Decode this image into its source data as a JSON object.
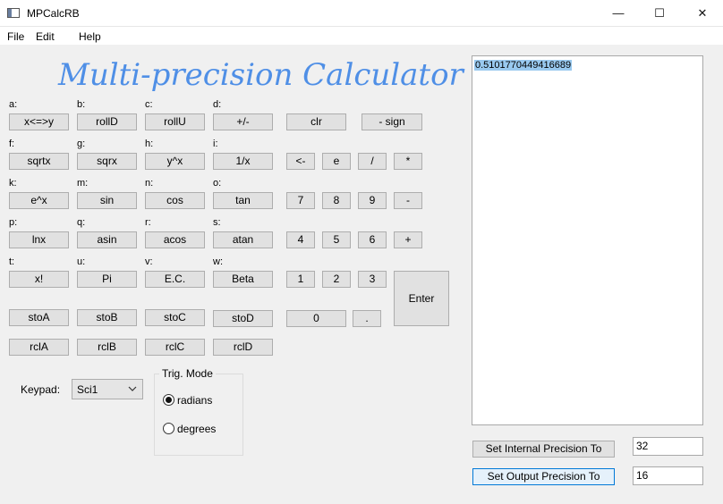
{
  "window": {
    "title": "MPCalcRB",
    "minimize": "—",
    "maximize": "☐",
    "close": "✕"
  },
  "menu": [
    "File",
    "Edit",
    "Help"
  ],
  "heading": "Multi-precision Calculator",
  "keys": {
    "row1": {
      "labels": [
        "a:",
        "b:",
        "c:",
        "d:"
      ],
      "buttons": [
        "x<=>y",
        "rollD",
        "rollU",
        "+/-",
        "clr",
        "- sign"
      ]
    },
    "row2": {
      "labels": [
        "f:",
        "g:",
        "h:",
        "i:"
      ],
      "buttons": [
        "sqrtx",
        "sqrx",
        "y^x",
        "1/x",
        "<-",
        "e",
        "/",
        "*"
      ]
    },
    "row3": {
      "labels": [
        "k:",
        "m:",
        "n:",
        "o:"
      ],
      "buttons": [
        "e^x",
        "sin",
        "cos",
        "tan",
        "7",
        "8",
        "9",
        "-"
      ]
    },
    "row4": {
      "labels": [
        "p:",
        "q:",
        "r:",
        "s:"
      ],
      "buttons": [
        "lnx",
        "asin",
        "acos",
        "atan",
        "4",
        "5",
        "6",
        "+"
      ]
    },
    "row5": {
      "labels": [
        "t:",
        "u:",
        "v:",
        "w:"
      ],
      "buttons": [
        "x!",
        "Pi",
        "E.C.",
        "Beta",
        "1",
        "2",
        "3"
      ]
    },
    "enter": "Enter",
    "sto": [
      "stoA",
      "stoB",
      "stoC",
      "stoD",
      "0",
      "."
    ],
    "rcl": [
      "rclA",
      "rclB",
      "rclC",
      "rclD"
    ]
  },
  "keypad": {
    "label": "Keypad:",
    "value": "Sci1"
  },
  "trig": {
    "title": "Trig. Mode",
    "radians": "radians",
    "degrees": "degrees",
    "selected": "radians"
  },
  "output": {
    "value": "0.5101770449416689"
  },
  "precision": {
    "internal_button": "Set Internal Precision To",
    "internal_value": "32",
    "output_button": "Set Output Precision To",
    "output_value": "16"
  },
  "colors": {
    "heading": "#4f8fe6",
    "selection": "#99c9ef",
    "focus": "#0078d7"
  }
}
